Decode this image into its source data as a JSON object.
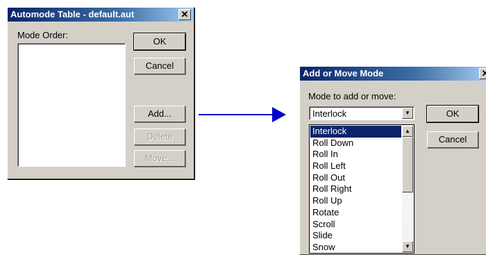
{
  "automode_dialog": {
    "title": "Automode Table - default.aut",
    "close_glyph": "✕",
    "mode_order_label": "Mode Order:",
    "ok_label": "OK",
    "cancel_label": "Cancel",
    "add_label": "Add...",
    "delete_label": "Delete",
    "move_label": "Move..."
  },
  "add_move_dialog": {
    "title": "Add or Move Mode",
    "close_glyph": "✕",
    "mode_label": "Mode to add or move:",
    "selected_value": "Interlock",
    "ok_label": "OK",
    "cancel_label": "Cancel",
    "options": [
      "Interlock",
      "Roll Down",
      "Roll In",
      "Roll Left",
      "Roll Out",
      "Roll Right",
      "Roll Up",
      "Rotate",
      "Scroll",
      "Slide",
      "Snow"
    ],
    "selected_index": 0
  },
  "icons": {
    "arrow": "right-arrow-icon",
    "combo_arrow": "▼",
    "scroll_up": "▲",
    "scroll_down": "▼"
  },
  "colors": {
    "dialog_face": "#d4d0c8",
    "titlebar": "#0a246a",
    "selection": "#0a246a",
    "arrow": "#0000cc"
  }
}
